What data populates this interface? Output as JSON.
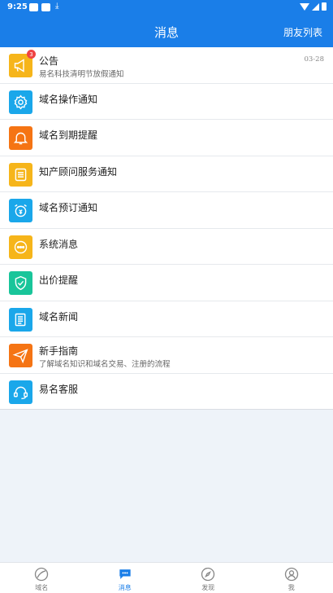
{
  "status_bar": {
    "time": "9:25"
  },
  "header": {
    "title": "消息",
    "right_link": "朋友列表"
  },
  "messages": [
    {
      "title": "公告",
      "subtitle": "易名科技清明节放假通知",
      "date": "03-28",
      "badge": "3",
      "icon": "megaphone-icon",
      "color": "#f6b51a"
    },
    {
      "title": "域名操作通知",
      "icon": "gear-icon",
      "color": "#1aa7ea"
    },
    {
      "title": "域名到期提醒",
      "icon": "bell-icon",
      "color": "#f57414"
    },
    {
      "title": "知产顾问服务通知",
      "icon": "document-icon",
      "color": "#f6b51a"
    },
    {
      "title": "域名预订通知",
      "icon": "alarm-clock-icon",
      "color": "#1aa7ea"
    },
    {
      "title": "系统消息",
      "icon": "chat-dots-icon",
      "color": "#f6b51a"
    },
    {
      "title": "出价提醒",
      "icon": "shield-check-icon",
      "color": "#19c59a"
    },
    {
      "title": "域名新闻",
      "icon": "newspaper-icon",
      "color": "#1aa7ea"
    },
    {
      "title": "新手指南",
      "subtitle": "了解域名知识和域名交易、注册的流程",
      "icon": "paper-plane-icon",
      "color": "#f57414"
    },
    {
      "title": "易名客服",
      "icon": "headset-icon",
      "color": "#1aa7ea"
    }
  ],
  "bottom_nav": [
    {
      "label": "域名",
      "icon": "domain-icon"
    },
    {
      "label": "消息",
      "icon": "message-icon",
      "active": true
    },
    {
      "label": "发现",
      "icon": "compass-icon"
    },
    {
      "label": "我",
      "icon": "profile-icon"
    }
  ]
}
